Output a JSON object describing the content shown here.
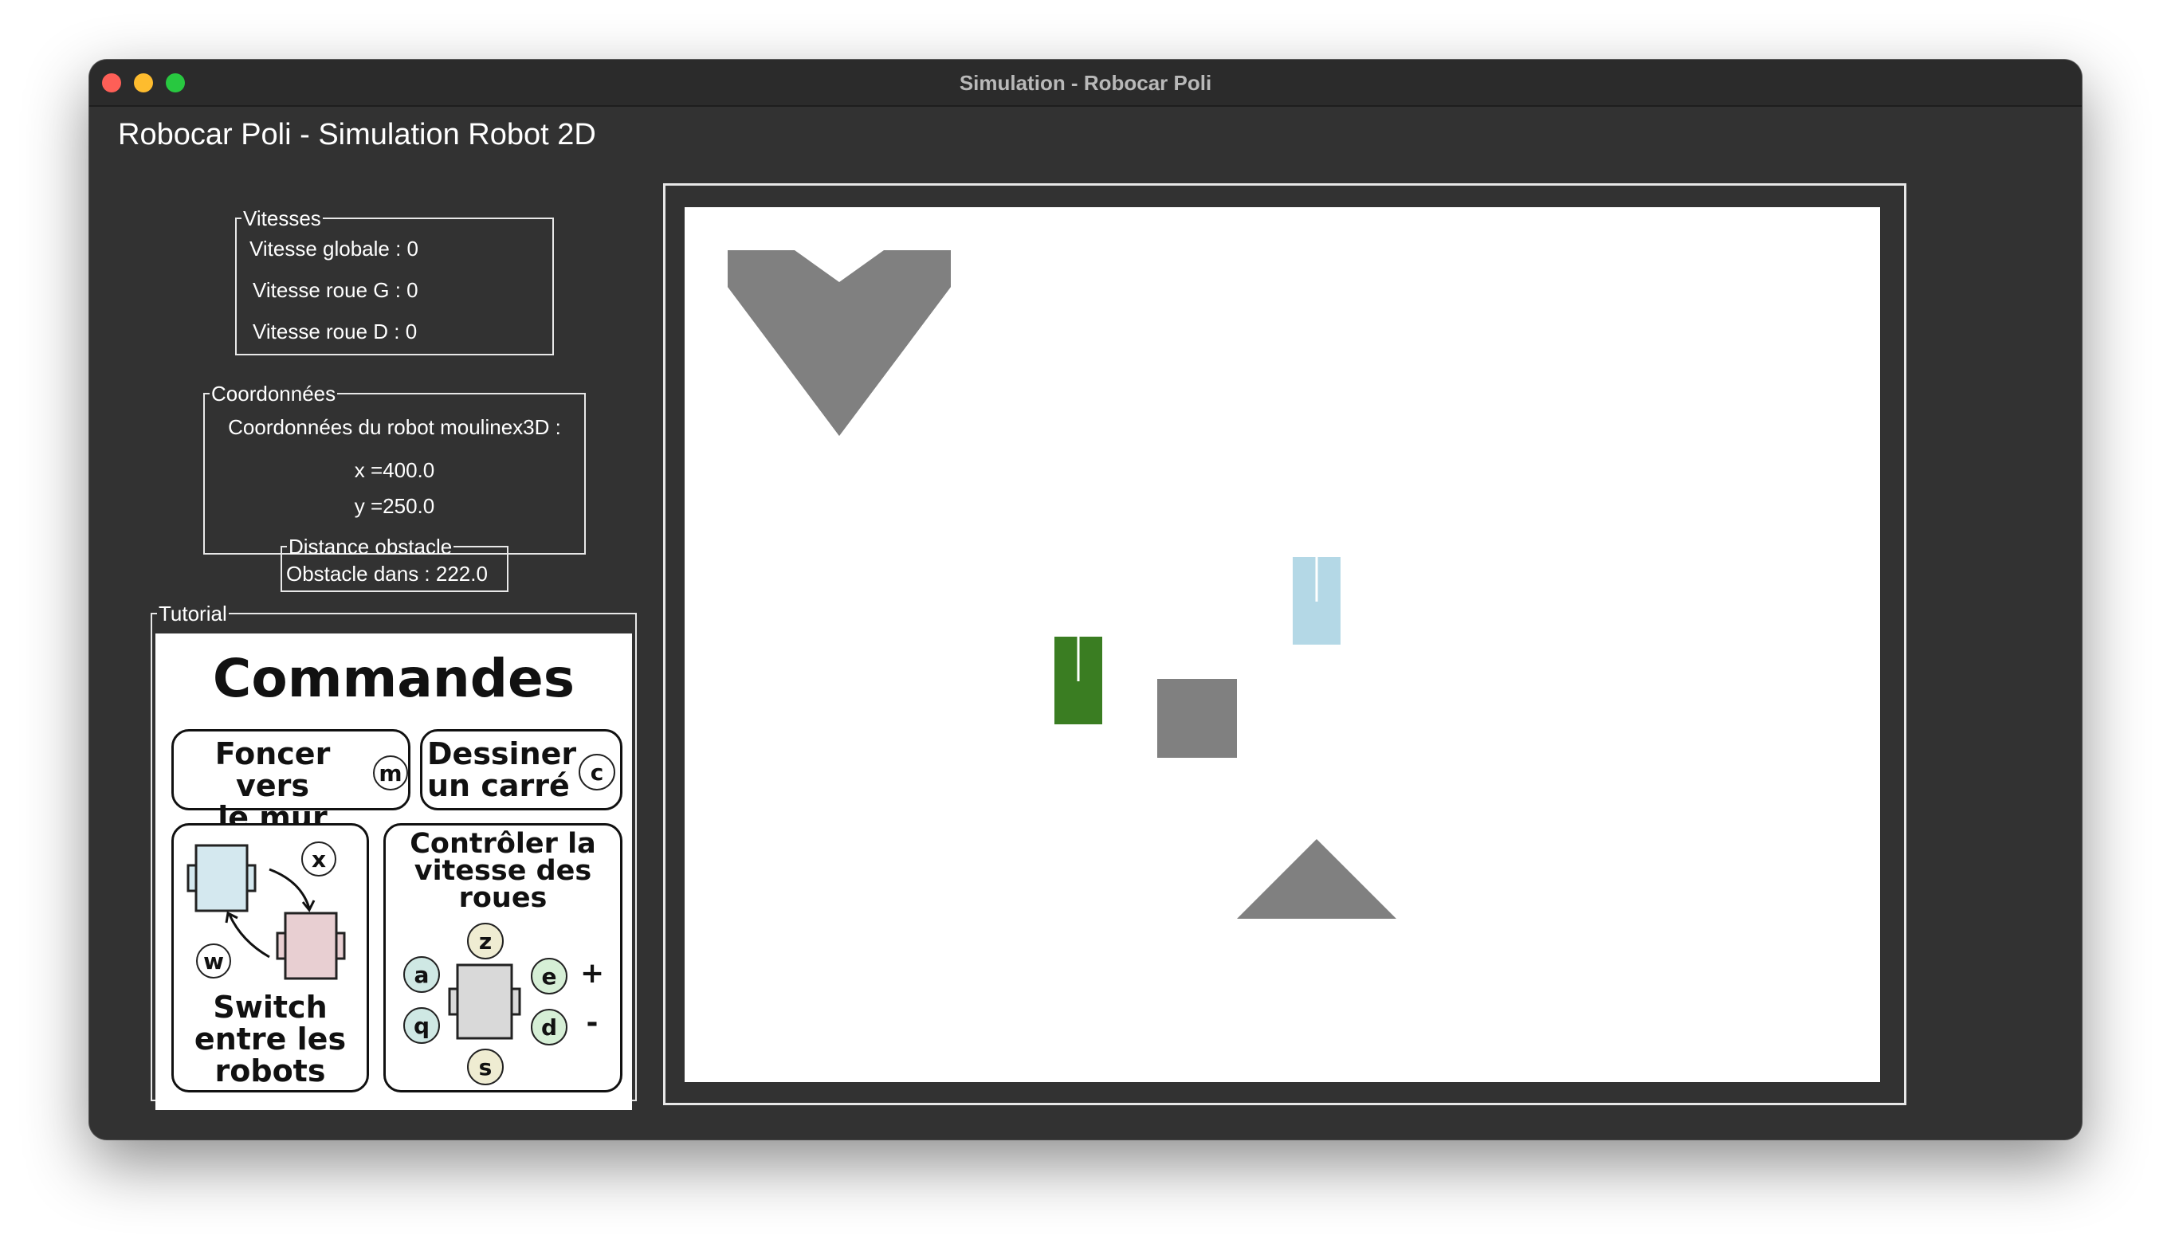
{
  "window": {
    "title": "Simulation - Robocar Poli"
  },
  "app": {
    "heading": "Robocar Poli - Simulation Robot 2D"
  },
  "vitesses": {
    "legend": "Vitesses",
    "globale": "Vitesse globale : 0",
    "roue_g": "Vitesse roue G : 0",
    "roue_d": "Vitesse roue D : 0"
  },
  "coordonnees": {
    "legend": "Coordonnées",
    "heading": "Coordonnées du robot moulinex3D :",
    "x": "x =400.0",
    "y": "y =250.0"
  },
  "distance": {
    "legend": "Distance obstacle",
    "value": "Obstacle dans : 222.0"
  },
  "tutorial": {
    "legend": "Tutorial",
    "title": "Commandes",
    "wall_line1": "Foncer vers",
    "wall_line2": "le mur",
    "wall_key": "m",
    "square_line1": "Dessiner",
    "square_line2": "un carré",
    "square_key": "c",
    "switch_line1": "Switch",
    "switch_line2": "entre les",
    "switch_line3": "robots",
    "switch_key_x": "x",
    "switch_key_w": "w",
    "speed_line1": "Contrôler la",
    "speed_line2": "vitesse des",
    "speed_line3": "roues",
    "key_z": "z",
    "key_a": "a",
    "key_q": "q",
    "key_e": "e",
    "key_d": "d",
    "key_s": "s",
    "plus": "+",
    "minus": "-"
  },
  "colors": {
    "obstacle": "#808080",
    "robot_active": "#3a7d22",
    "robot_inactive": "#b4d8e6",
    "key_teal": "#cfe8e4",
    "key_cream": "#efecd2",
    "key_green": "#d6efd6",
    "robot_icon_blue": "#d4e8ef",
    "robot_icon_pink": "#e8cfd2",
    "robot_icon_gray": "#d9d9d9"
  }
}
